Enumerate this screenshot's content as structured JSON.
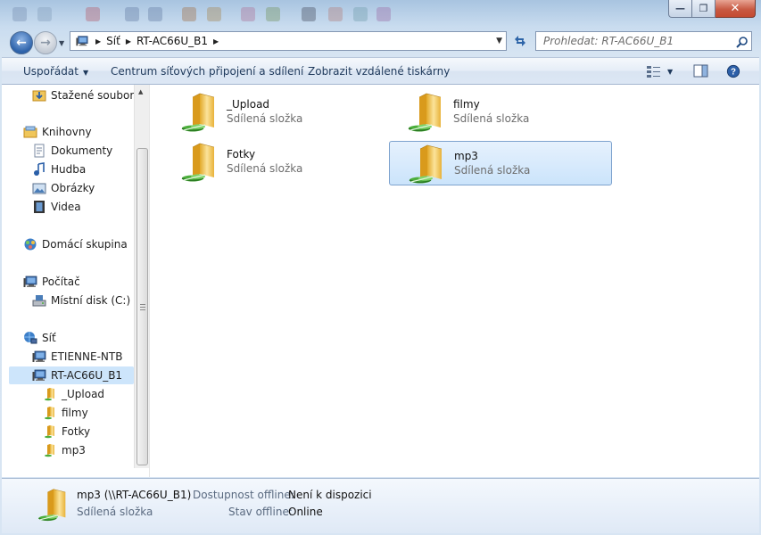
{
  "window": {
    "min_label": "—",
    "max_label": "❐",
    "close_label": "✕"
  },
  "address": {
    "crumbs": [
      "Síť",
      "RT-AC66U_B1"
    ],
    "search_placeholder": "Prohledat: RT-AC66U_B1"
  },
  "toolbar": {
    "organize": "Uspořádat",
    "network_center": "Centrum síťových připojení a sdílení",
    "printers": "Zobrazit vzdálené tiskárny"
  },
  "nav": {
    "downloads": "Stažené soubory",
    "libraries": "Knihovny",
    "documents": "Dokumenty",
    "music": "Hudba",
    "pictures": "Obrázky",
    "videos": "Videa",
    "homegroup": "Domácí skupina",
    "computer": "Počítač",
    "local_disk": "Místní disk (C:)",
    "network": "Síť",
    "pc1": "ETIENNE-NTB",
    "pc2": "RT-AC66U_B1",
    "sub": [
      "_Upload",
      "filmy",
      "Fotky",
      "mp3"
    ]
  },
  "folders": [
    {
      "name": "_Upload",
      "type": "Sdílená složka"
    },
    {
      "name": "filmy",
      "type": "Sdílená složka"
    },
    {
      "name": "Fotky",
      "type": "Sdílená složka"
    },
    {
      "name": "mp3",
      "type": "Sdílená složka"
    }
  ],
  "details": {
    "name": "mp3 (\\\\RT-AC66U_B1)",
    "type": "Sdílená složka",
    "offline_avail_label": "Dostupnost offline:",
    "offline_avail_value": "Není k dispozici",
    "offline_status_label": "Stav offline:",
    "offline_status_value": "Online"
  },
  "colors": {
    "accent": "#1e395b",
    "selection": "#cde5fb",
    "folder": "#f2c94c"
  }
}
